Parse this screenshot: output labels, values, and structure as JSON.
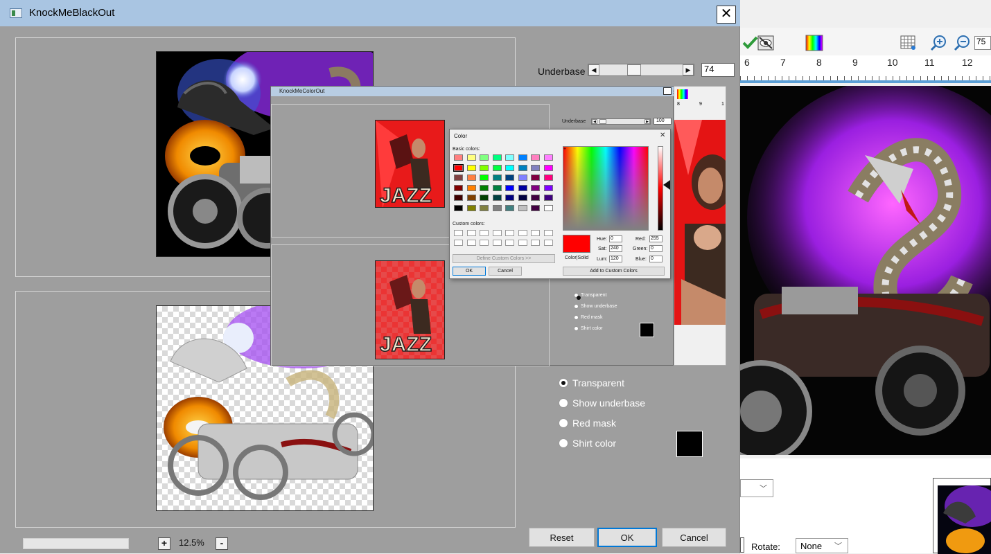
{
  "main_window": {
    "title": "KnockMeBlackOut",
    "close_glyph": "✕",
    "underbase": {
      "label": "Underbase",
      "value": "74",
      "slider_fraction": 0.39
    },
    "radios": [
      {
        "label": "Transparent",
        "checked": true
      },
      {
        "label": "Show underbase",
        "checked": false
      },
      {
        "label": "Red mask",
        "checked": false
      },
      {
        "label": "Shirt color",
        "checked": false
      }
    ],
    "shirt_color": "#000000",
    "zoom": {
      "plus": "+",
      "minus": "-",
      "value": "12.5%"
    },
    "buttons": {
      "reset": "Reset",
      "ok": "OK",
      "cancel": "Cancel"
    }
  },
  "color_out_window": {
    "title": "KnockMeColorOut",
    "underbase": {
      "label": "Underbase",
      "value": "100",
      "slider_fraction": 0.05
    },
    "radios": [
      {
        "label": "Transparent",
        "checked": true
      },
      {
        "label": "Show underbase",
        "checked": false
      },
      {
        "label": "Red mask",
        "checked": false
      },
      {
        "label": "Shirt color",
        "checked": false
      }
    ],
    "right_ruler": [
      "8",
      "9",
      "1"
    ]
  },
  "color_dialog": {
    "title": "Color",
    "basic_colors_label": "Basic colors:",
    "custom_colors_label": "Custom colors:",
    "define_custom_button": "Define Custom Colors >>",
    "ok_button": "OK",
    "cancel_button": "Cancel",
    "add_custom_button": "Add to Custom Colors",
    "color_solid_label": "Color|Solid",
    "selected_color": "#ff0000",
    "fields": {
      "hue": {
        "label": "Hue:",
        "value": "0"
      },
      "sat": {
        "label": "Sat:",
        "value": "240"
      },
      "lum": {
        "label": "Lum:",
        "value": "120"
      },
      "red": {
        "label": "Red:",
        "value": "255"
      },
      "green": {
        "label": "Green:",
        "value": "0"
      },
      "blue": {
        "label": "Blue:",
        "value": "0"
      }
    },
    "basic_colors": [
      [
        "#ff8080",
        "#ffff80",
        "#80ff80",
        "#00ff80",
        "#80ffff",
        "#0080ff",
        "#ff80c0",
        "#ff80ff"
      ],
      [
        "#ff0000",
        "#ffff00",
        "#80ff00",
        "#00ff40",
        "#00ffff",
        "#0080c0",
        "#8080c0",
        "#ff00ff"
      ],
      [
        "#804040",
        "#ff8040",
        "#00ff00",
        "#008080",
        "#004080",
        "#8080ff",
        "#800040",
        "#ff0080"
      ],
      [
        "#800000",
        "#ff8000",
        "#008000",
        "#008040",
        "#0000ff",
        "#0000a0",
        "#800080",
        "#8000ff"
      ],
      [
        "#400000",
        "#804000",
        "#004000",
        "#004040",
        "#000080",
        "#000040",
        "#400040",
        "#400080"
      ],
      [
        "#000000",
        "#808000",
        "#808040",
        "#808080",
        "#408080",
        "#c0c0c0",
        "#400040",
        "#ffffff"
      ]
    ]
  },
  "background_app": {
    "ruler_numbers": [
      "6",
      "7",
      "8",
      "9",
      "10",
      "11",
      "12"
    ],
    "zoom_partial": "75",
    "rotate_label": "Rotate:",
    "rotate_value": "None"
  }
}
